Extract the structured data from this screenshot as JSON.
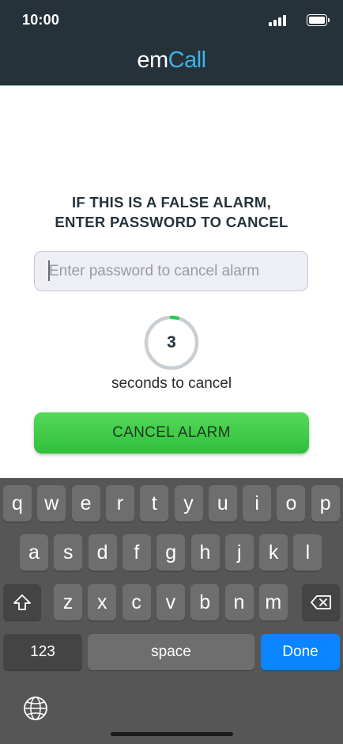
{
  "status_bar": {
    "time": "10:00"
  },
  "brand": {
    "part1": "em",
    "part2": "Call"
  },
  "alarm": {
    "heading_line1": "IF THIS IS A FALSE ALARM,",
    "heading_line2": "ENTER PASSWORD TO CANCEL",
    "password_placeholder": "Enter password to cancel alarm",
    "countdown_value": "3",
    "countdown_label": "seconds to cancel",
    "countdown_progress": 0.04,
    "cancel_button": "CANCEL ALARM"
  },
  "keyboard": {
    "row1": [
      "q",
      "w",
      "e",
      "r",
      "t",
      "y",
      "u",
      "i",
      "o",
      "p"
    ],
    "row2": [
      "a",
      "s",
      "d",
      "f",
      "g",
      "h",
      "j",
      "k",
      "l"
    ],
    "row3": [
      "z",
      "x",
      "c",
      "v",
      "b",
      "n",
      "m"
    ],
    "numbers_key": "123",
    "space_key": "space",
    "done_key": "Done"
  },
  "colors": {
    "header_bg": "#26323a",
    "brand_accent": "#3fb4e6",
    "button_green": "#3ecb46",
    "progress_green": "#2ecc55",
    "done_blue": "#0a84ff"
  }
}
